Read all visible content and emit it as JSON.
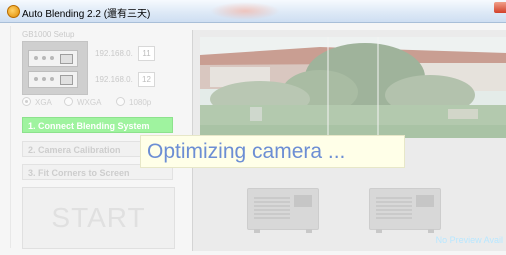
{
  "window": {
    "title": "Auto Blending 2.2 (還有三天)",
    "accent": "#9ff39f",
    "overlay_text_color": "#6c8ed4"
  },
  "setup": {
    "label": "GB1000 Setup",
    "ip_prefix_1": "192.168.0.",
    "ip_value_1": "11",
    "ip_prefix_2": "192.168.0.",
    "ip_value_2": "12"
  },
  "resolution": {
    "options": [
      "XGA",
      "WXGA",
      "1080p"
    ],
    "selected": "XGA"
  },
  "steps": {
    "connect": "1. Connect Blending System",
    "calibration": "2. Camera Calibration",
    "fit": "3. Fit Corners to Screen",
    "start": "START"
  },
  "preview": {
    "caption": "No Preview Avail"
  },
  "overlay": {
    "message": "Optimizing camera ..."
  },
  "icons": [
    "app-icon",
    "network-device-icon",
    "projector-icon"
  ]
}
